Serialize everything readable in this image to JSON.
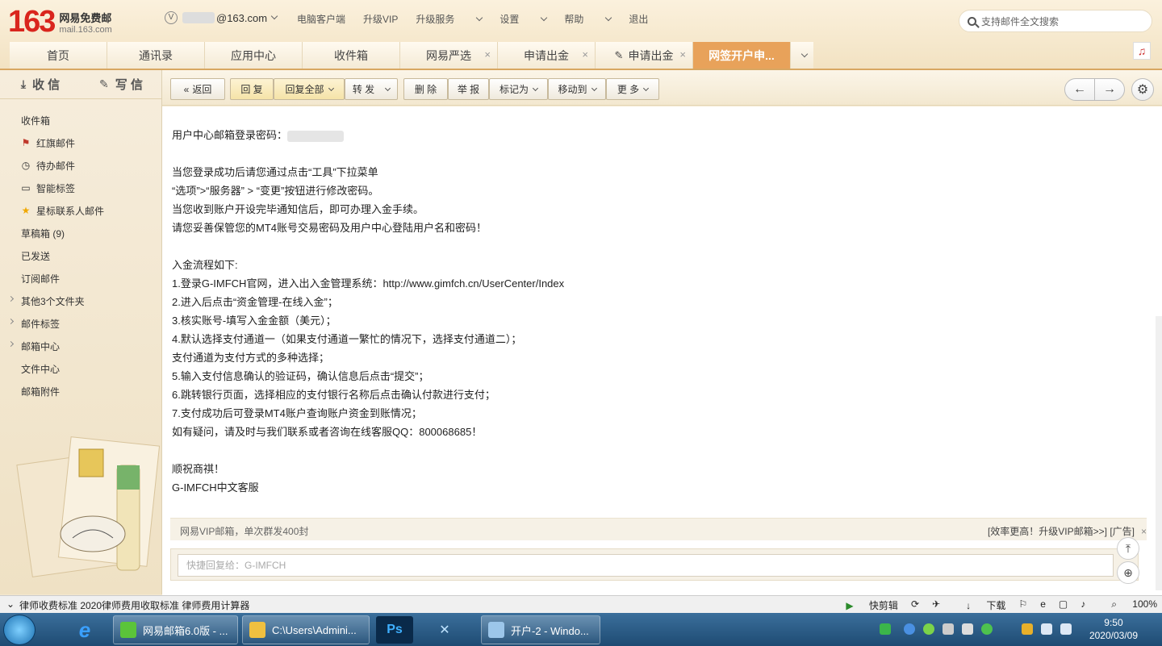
{
  "header": {
    "logo_num": "163",
    "logo_cn": "网易免费邮",
    "logo_url": "mail.163.com",
    "account_v": "V",
    "account_suffix": "@163.com",
    "nav": [
      "电脑客户端",
      "升级VIP",
      "升级服务",
      "设置",
      "帮助",
      "退出"
    ],
    "search_placeholder": "支持邮件全文搜索"
  },
  "tabs": [
    {
      "label": "首页"
    },
    {
      "label": "通讯录"
    },
    {
      "label": "应用中心"
    },
    {
      "label": "收件箱"
    },
    {
      "label": "网易严选"
    },
    {
      "label": "申请出金"
    },
    {
      "label": "申请出金"
    },
    {
      "label": "网签开户申..."
    }
  ],
  "sidebar": {
    "receive": "收 信",
    "write": "写 信",
    "folders": [
      {
        "label": "收件箱"
      },
      {
        "label": "红旗邮件"
      },
      {
        "label": "待办邮件"
      },
      {
        "label": "智能标签"
      },
      {
        "label": "星标联系人邮件"
      },
      {
        "label": "草稿箱 (9)"
      },
      {
        "label": "已发送"
      },
      {
        "label": "订阅邮件"
      },
      {
        "label": "其他3个文件夹"
      },
      {
        "label": "邮件标签"
      },
      {
        "label": "邮箱中心"
      },
      {
        "label": "文件中心"
      },
      {
        "label": "邮箱附件"
      }
    ]
  },
  "toolbar": {
    "back": "返回",
    "reply": "回 复",
    "reply_all": "回复全部",
    "forward": "转 发",
    "delete": "删 除",
    "report": "举 报",
    "mark_as": "标记为",
    "move_to": "移动到",
    "more": "更 多"
  },
  "mail": {
    "lines": [
      "用户中心邮箱登录密码：",
      "",
      "当您登录成功后请您通过点击“工具”下拉菜单",
      "“选项”>“服务器” > “变更”按钮进行修改密码。",
      "当您收到账户开设完毕通知信后，即可办理入金手续。",
      "请您妥善保管您的MT4账号交易密码及用户中心登陆用户名和密码！",
      "",
      "入金流程如下:",
      "1.登录G-IMFCH官网，进入出入金管理系统：http://www.gimfch.cn/UserCenter/Index",
      "2.进入后点击“资金管理-在线入金”；",
      "3.核实账号-填写入金金额（美元）；",
      "4.默认选择支付通道一（如果支付通道一繁忙的情况下，选择支付通道二）；",
      "支付通道为支付方式的多种选择；",
      "5.输入支付信息确认的验证码，确认信息后点击“提交”；",
      "6.跳转银行页面，选择相应的支付银行名称后点击确认付款进行支付；",
      "7.支付成功后可登录MT4账户查询账户资金到账情况；",
      "如有疑问，请及时与我们联系或者咨询在线客服QQ：800068685！",
      "",
      "顺祝商祺！",
      "G-IMFCH中文客服"
    ]
  },
  "ad": {
    "left": "网易VIP邮箱，单次群发400封",
    "right": "[效率更高！升级VIP邮箱>>] [广告]"
  },
  "reply_placeholder": "快捷回复给：G-IMFCH",
  "statusbar": {
    "left": "律师收费标准 2020律师费用收取标准 律师费用计算器",
    "clip": "快剪辑",
    "download": "下载",
    "zoom": "100%"
  },
  "taskbar": {
    "tasks": [
      "网易邮箱6.0版 - ...",
      "C:\\Users\\Admini...",
      "开户-2 - Windo..."
    ],
    "time": "9:50",
    "date": "2020/03/09"
  },
  "colors": {
    "brand_red": "#d9251d",
    "active_tab": "#e8a25a"
  }
}
